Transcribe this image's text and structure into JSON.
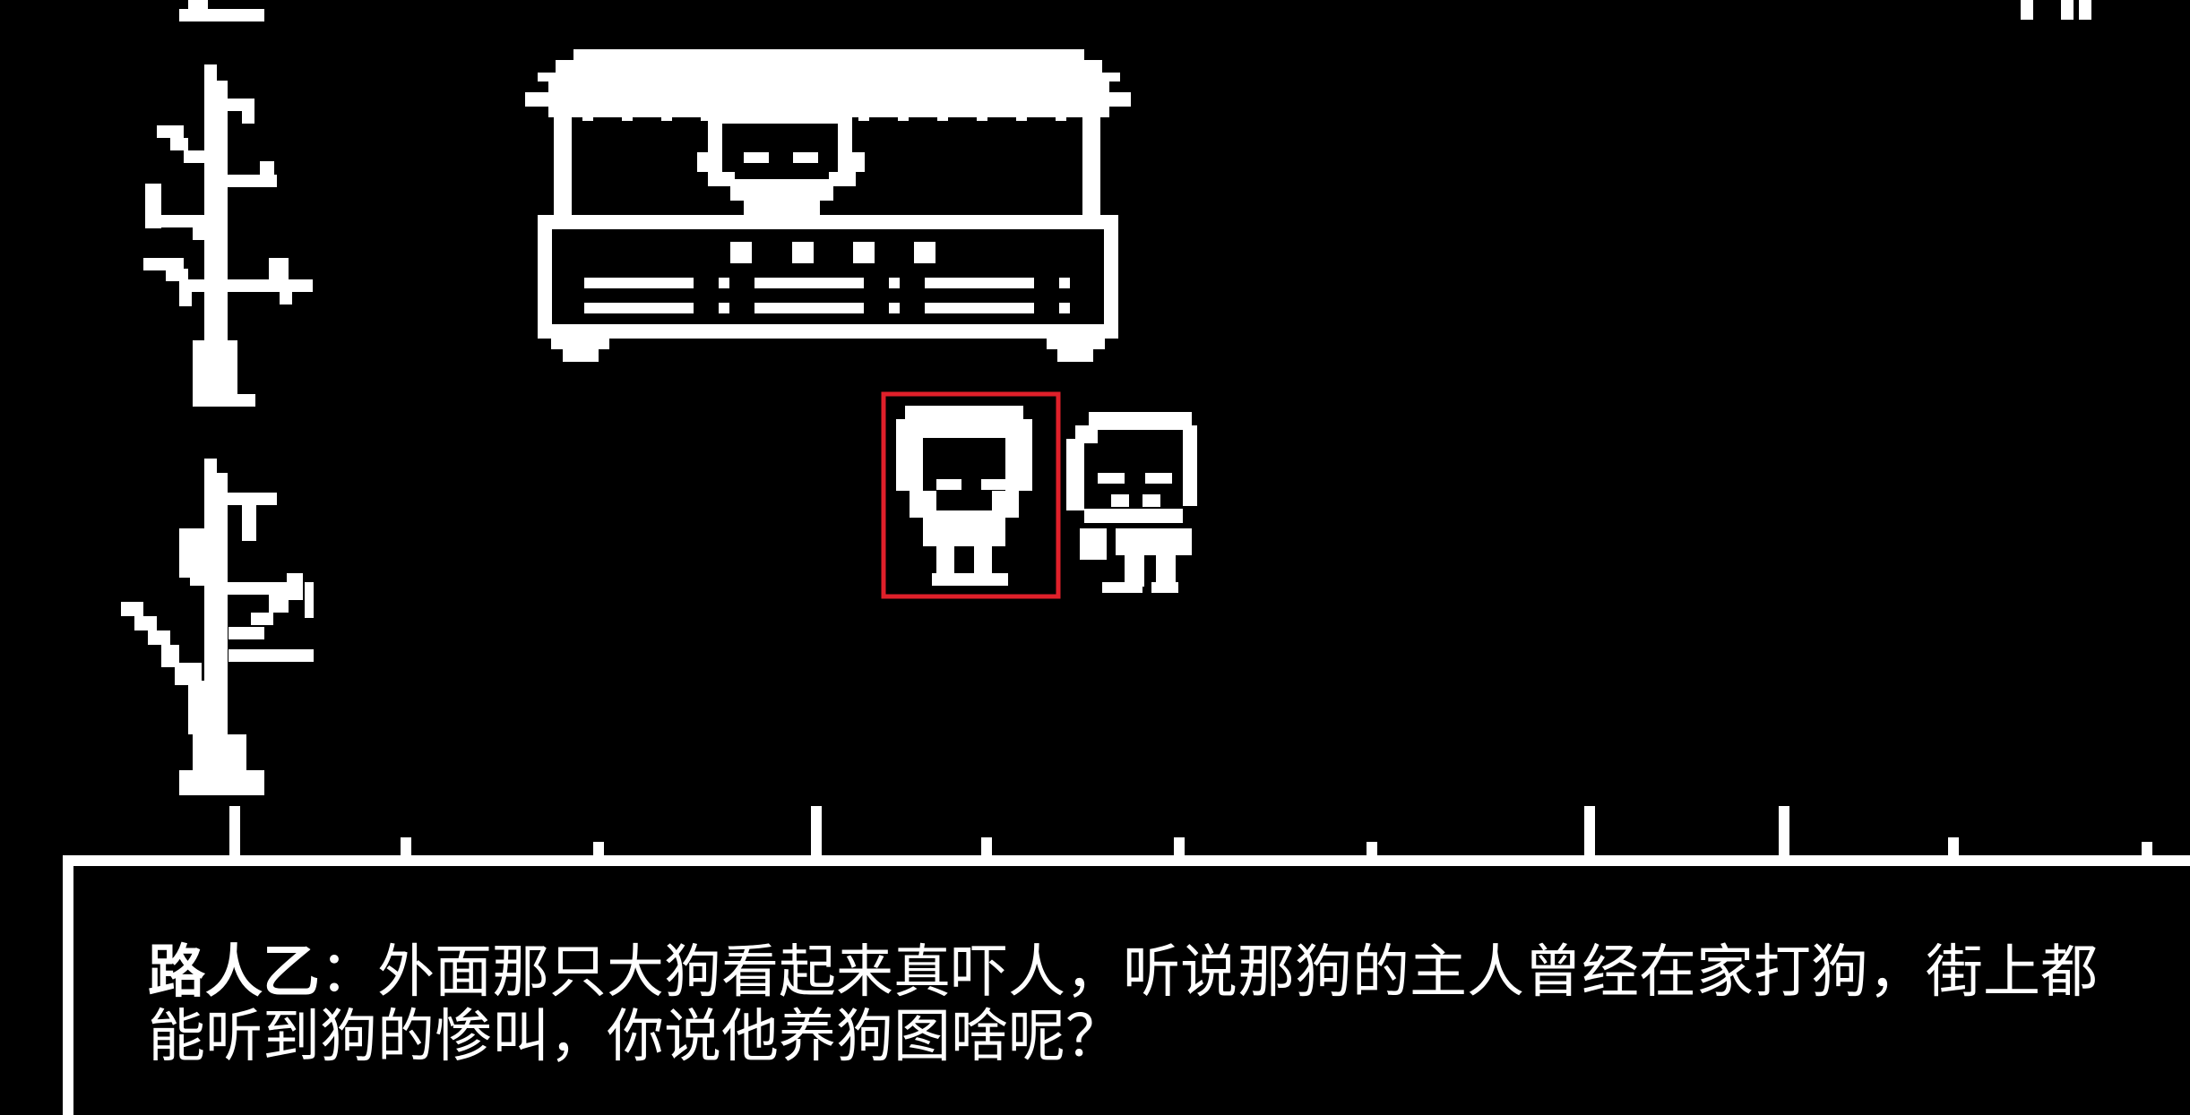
{
  "dialog": {
    "speaker": "路人乙",
    "separator": "：",
    "text": "外面那只大狗看起来真吓人，听说那狗的主人曾经在家打狗，街上都能听到狗的惨叫，你说他养狗图啥呢？"
  },
  "colors": {
    "background": "#000000",
    "foreground": "#ffffff",
    "selection": "#e0202a"
  }
}
